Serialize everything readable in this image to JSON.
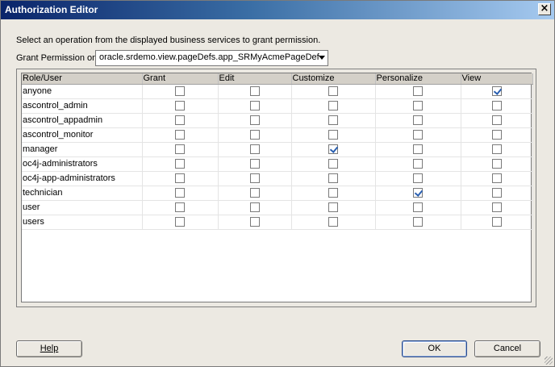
{
  "window": {
    "title": "Authorization Editor",
    "close_glyph": "×"
  },
  "instructions": "Select an operation from the displayed business services to grant permission.",
  "grant": {
    "label": "Grant Permission on:",
    "selected_value": "oracle.srdemo.view.pageDefs.app_SRMyAcmePageDef"
  },
  "table": {
    "columns": [
      "Role/User",
      "Grant",
      "Edit",
      "Customize",
      "Personalize",
      "View"
    ],
    "rows": [
      {
        "role": "anyone",
        "perms": [
          false,
          false,
          false,
          false,
          true
        ]
      },
      {
        "role": "ascontrol_admin",
        "perms": [
          false,
          false,
          false,
          false,
          false
        ]
      },
      {
        "role": "ascontrol_appadmin",
        "perms": [
          false,
          false,
          false,
          false,
          false
        ]
      },
      {
        "role": "ascontrol_monitor",
        "perms": [
          false,
          false,
          false,
          false,
          false
        ]
      },
      {
        "role": "manager",
        "perms": [
          false,
          false,
          true,
          false,
          false
        ]
      },
      {
        "role": "oc4j-administrators",
        "perms": [
          false,
          false,
          false,
          false,
          false
        ]
      },
      {
        "role": "oc4j-app-administrators",
        "perms": [
          false,
          false,
          false,
          false,
          false
        ]
      },
      {
        "role": "technician",
        "perms": [
          false,
          false,
          false,
          true,
          false
        ]
      },
      {
        "role": "user",
        "perms": [
          false,
          false,
          false,
          false,
          false
        ]
      },
      {
        "role": "users",
        "perms": [
          false,
          false,
          false,
          false,
          false
        ]
      }
    ]
  },
  "buttons": {
    "help": "Help",
    "ok": "OK",
    "cancel": "Cancel"
  },
  "colors": {
    "title_gradient_start": "#0a246a",
    "title_gradient_end": "#a6caf0",
    "check": "#2a5fb0"
  }
}
